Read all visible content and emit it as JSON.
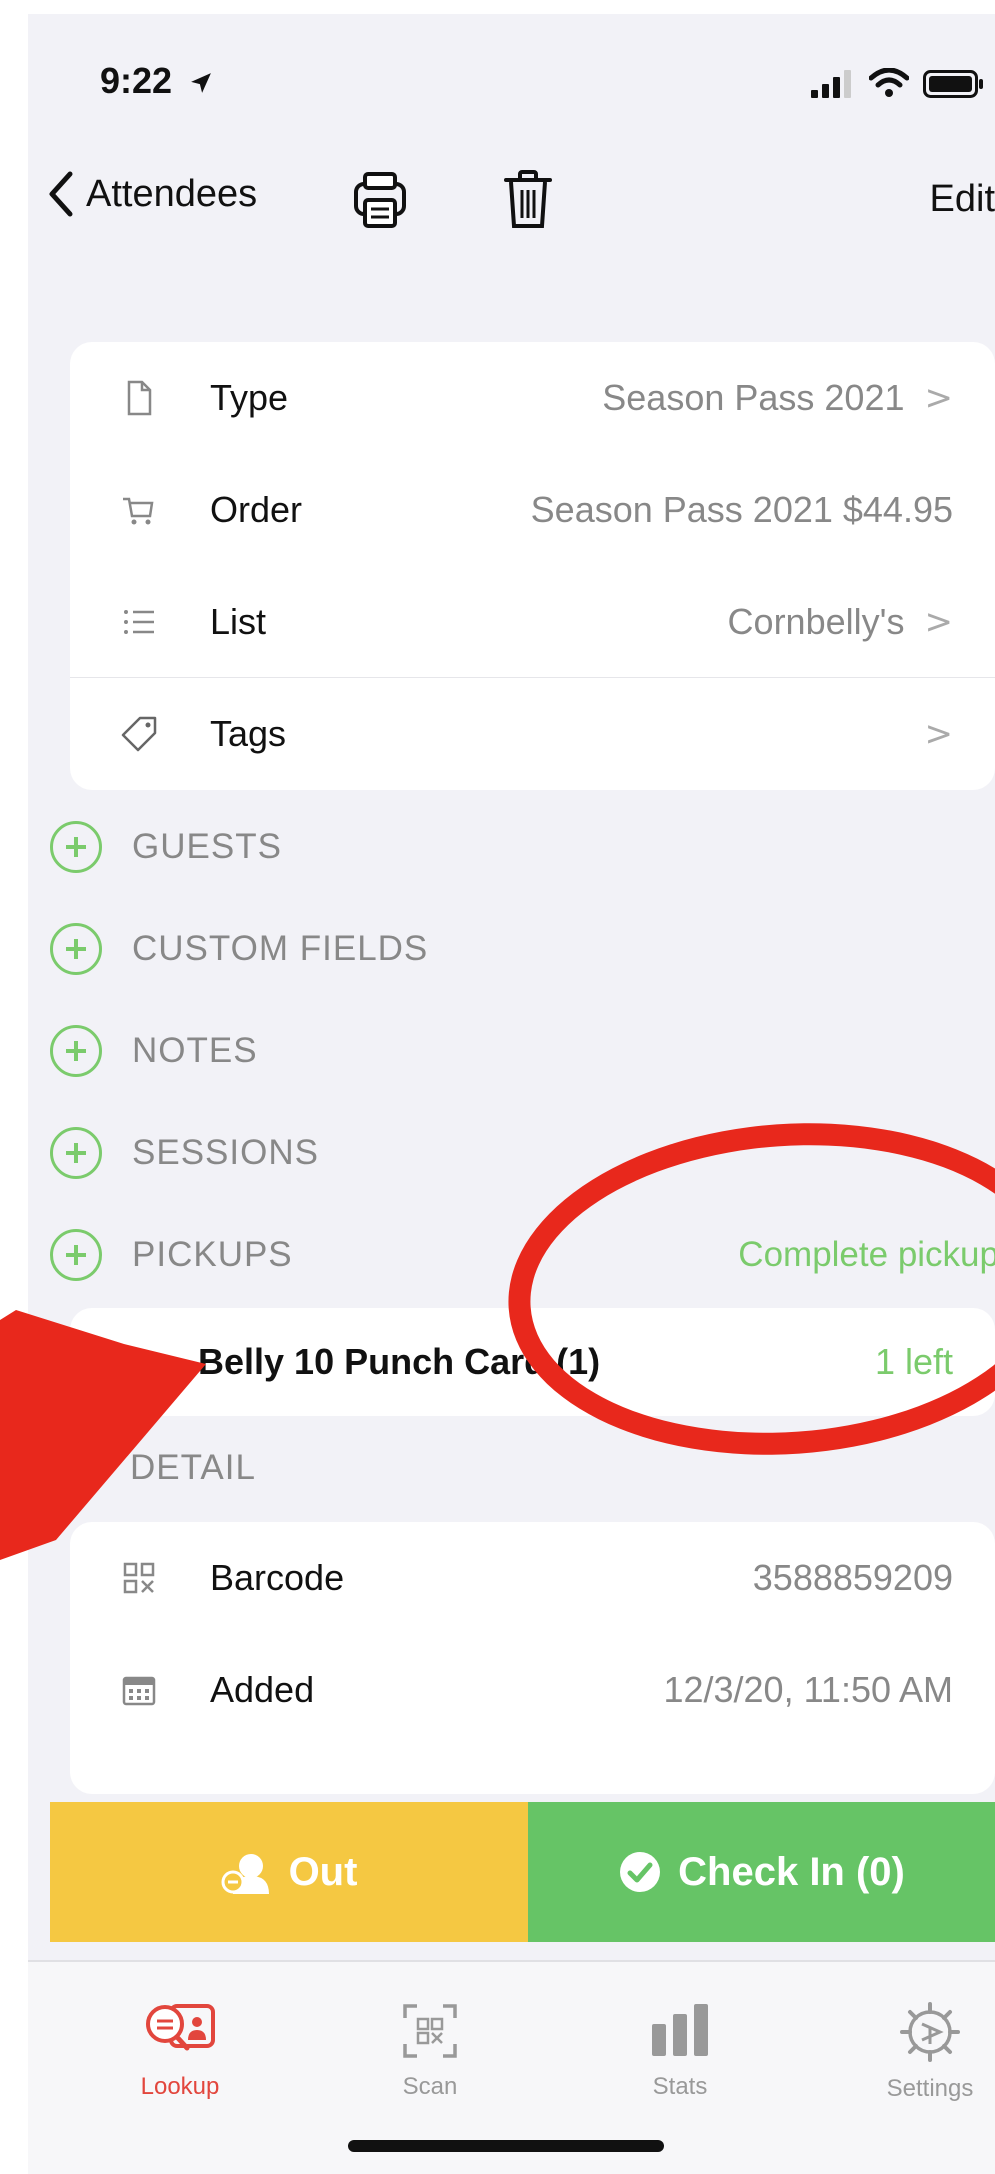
{
  "status_bar": {
    "time": "9:22"
  },
  "nav": {
    "back_label": "Attendees",
    "edit_label": "Edit"
  },
  "info_rows": [
    {
      "label": "Type",
      "value": "Season Pass 2021",
      "chevron": true,
      "icon": "document-icon"
    },
    {
      "label": "Order",
      "value": "Season Pass 2021 $44.95",
      "chevron": false,
      "icon": "cart-icon"
    },
    {
      "label": "List",
      "value": "Cornbelly's",
      "chevron": true,
      "icon": "list-icon"
    },
    {
      "label": "Tags",
      "value": "",
      "chevron": true,
      "icon": "tag-icon"
    }
  ],
  "chevron": ">",
  "sections": {
    "guests": "GUESTS",
    "custom_fields": "CUSTOM FIELDS",
    "notes": "NOTES",
    "sessions": "SESSIONS",
    "pickups": "PICKUPS",
    "pickups_action": "Complete pickup"
  },
  "pickup_item": {
    "name": "Belly 10 Punch Card (1)",
    "status": "1 left"
  },
  "detail": {
    "title": "DETAIL",
    "rows": [
      {
        "label": "Barcode",
        "value": "3588859209",
        "icon": "barcode-icon"
      },
      {
        "label": "Added",
        "value": "12/3/20, 11:50 AM",
        "icon": "calendar-icon"
      }
    ]
  },
  "actions": {
    "out_label": "Out",
    "checkin_label": "Check In (0)"
  },
  "tabs": [
    {
      "label": "Lookup",
      "icon": "lookup-icon",
      "active": true
    },
    {
      "label": "Scan",
      "icon": "scan-icon",
      "active": false
    },
    {
      "label": "Stats",
      "icon": "stats-icon",
      "active": false
    },
    {
      "label": "Settings",
      "icon": "settings-icon",
      "active": false
    }
  ],
  "colors": {
    "accent_green": "#66c466",
    "accent_yellow": "#f5c842",
    "tab_active": "#e2463d",
    "annotation_red": "#e8281c"
  }
}
